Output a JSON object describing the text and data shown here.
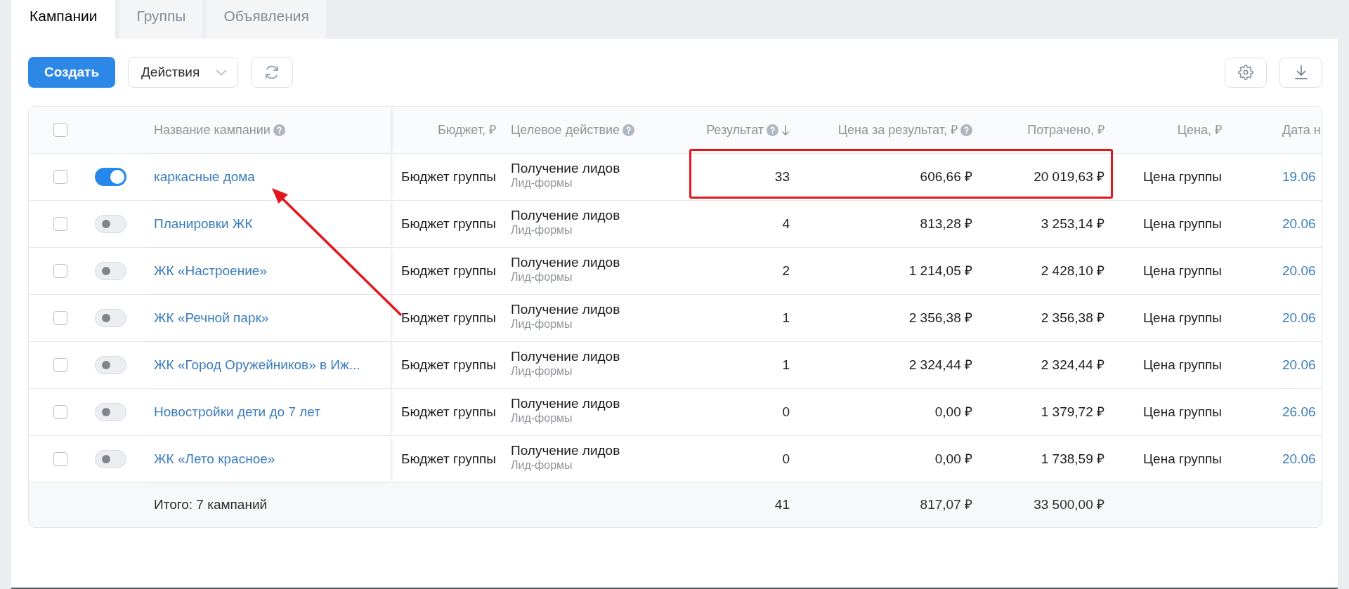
{
  "tabs": [
    {
      "label": "Кампании",
      "selected": true
    },
    {
      "label": "Группы",
      "selected": false
    },
    {
      "label": "Объявления",
      "selected": false
    }
  ],
  "toolbar": {
    "create_button": "Создать",
    "actions_dropdown": "Действия"
  },
  "table": {
    "select_all": {
      "checked": false
    },
    "columns": [
      {
        "label": "Название кампании",
        "help": true,
        "sorted": false
      },
      {
        "label": "Бюджет, ₽",
        "help": false,
        "sorted": false
      },
      {
        "label": "Целевое действие",
        "help": true,
        "sorted": false
      },
      {
        "label": "Результат",
        "help": true,
        "sorted": true
      },
      {
        "label": "Цена за результат, ₽",
        "help": true,
        "sorted": false
      },
      {
        "label": "Потрачено, ₽",
        "help": false,
        "sorted": false
      },
      {
        "label": "Цена, ₽",
        "help": false,
        "sorted": false
      },
      {
        "label": "Дата н",
        "help": false,
        "sorted": false
      }
    ],
    "rows": [
      {
        "checked": false,
        "on": true,
        "name": "каркасные дома",
        "budget": "Бюджет группы",
        "target_action": "Получение лидов",
        "target_subtype": "Лид-формы",
        "result": "33",
        "cost_per_result": "606,66 ₽",
        "spent": "20 019,63 ₽",
        "price": "Цена группы",
        "date": "19.06"
      },
      {
        "checked": false,
        "on": false,
        "name": "Планировки ЖК",
        "budget": "Бюджет группы",
        "target_action": "Получение лидов",
        "target_subtype": "Лид-формы",
        "result": "4",
        "cost_per_result": "813,28 ₽",
        "spent": "3 253,14 ₽",
        "price": "Цена группы",
        "date": "20.06"
      },
      {
        "checked": false,
        "on": false,
        "name": "ЖК «Настроение»",
        "budget": "Бюджет группы",
        "target_action": "Получение лидов",
        "target_subtype": "Лид-формы",
        "result": "2",
        "cost_per_result": "1 214,05 ₽",
        "spent": "2 428,10 ₽",
        "price": "Цена группы",
        "date": "20.06"
      },
      {
        "checked": false,
        "on": false,
        "name": "ЖК «Речной парк»",
        "budget": "Бюджет группы",
        "target_action": "Получение лидов",
        "target_subtype": "Лид-формы",
        "result": "1",
        "cost_per_result": "2 356,38 ₽",
        "spent": "2 356,38 ₽",
        "price": "Цена группы",
        "date": "20.06"
      },
      {
        "checked": false,
        "on": false,
        "name": "ЖК «Город Оружейников» в Иж...",
        "budget": "Бюджет группы",
        "target_action": "Получение лидов",
        "target_subtype": "Лид-формы",
        "result": "1",
        "cost_per_result": "2 324,44 ₽",
        "spent": "2 324,44 ₽",
        "price": "Цена группы",
        "date": "20.06"
      },
      {
        "checked": false,
        "on": false,
        "name": "Новостройки дети до 7 лет",
        "budget": "Бюджет группы",
        "target_action": "Получение лидов",
        "target_subtype": "Лид-формы",
        "result": "0",
        "cost_per_result": "0,00 ₽",
        "spent": "1 379,72 ₽",
        "price": "Цена группы",
        "date": "26.06"
      },
      {
        "checked": false,
        "on": false,
        "name": "ЖК «Лето красное»",
        "budget": "Бюджет группы",
        "target_action": "Получение лидов",
        "target_subtype": "Лид-формы",
        "result": "0",
        "cost_per_result": "0,00 ₽",
        "spent": "1 738,59 ₽",
        "price": "Цена группы",
        "date": "20.06"
      }
    ],
    "footer": {
      "label": "Итого: 7 кампаний",
      "result": "41",
      "cost_per_result": "817,07 ₽",
      "spent": "33 500,00 ₽"
    }
  },
  "annotations": {
    "highlight_frame": true,
    "arrow": true
  }
}
